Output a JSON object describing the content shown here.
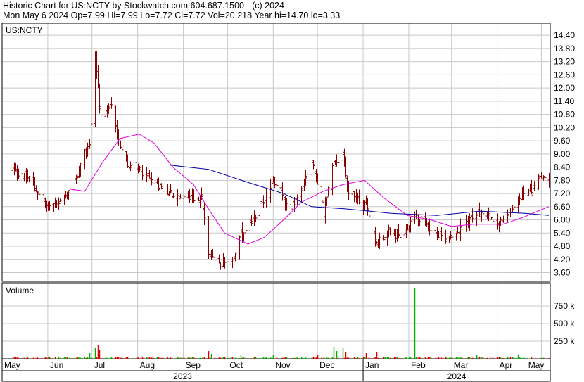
{
  "header": {
    "line1": "Historic Chart for US:NCTY by Stockwatch.com 604.687.1500 - (c) 2024",
    "line2": "Mon May  6 2024  Op=7.99  Hi=7.99  Lo=7.72  Cl=7.72  Vol=20,218  Year hi=14.70  lo=3.33"
  },
  "chart_data": [
    {
      "type": "bar",
      "subtype": "ohlc",
      "symbol_label": "US:NCTY",
      "y_ticks": [
        "3.60",
        "4.20",
        "4.80",
        "5.40",
        "6.00",
        "6.60",
        "7.20",
        "7.80",
        "8.40",
        "9.00",
        "9.60",
        "10.20",
        "10.80",
        "11.40",
        "12.00",
        "12.60",
        "13.20",
        "13.80",
        "14.40"
      ],
      "ylim": [
        3.2,
        14.95
      ],
      "x_month_labels": [
        "May",
        "Jun",
        "Jul",
        "Aug",
        "Sep",
        "Oct",
        "Nov",
        "Dec",
        "Jan",
        "Feb",
        "Mar",
        "Apr",
        "May"
      ],
      "x_year_labels": [
        "2023",
        "2024"
      ],
      "grid": true,
      "colors": {
        "bar": "#8b0000",
        "ma_short": "#e000e0",
        "ma_long": "#0000a0",
        "grid": "#c8c8c8"
      },
      "anchors": [
        [
          "2023-05-08",
          8.3
        ],
        [
          "2023-05-20",
          7.8
        ],
        [
          "2023-05-31",
          6.6
        ],
        [
          "2023-06-12",
          6.9
        ],
        [
          "2023-06-20",
          7.9
        ],
        [
          "2023-06-29",
          9.5
        ],
        [
          "2023-07-03",
          13.5
        ],
        [
          "2023-07-07",
          10.6
        ],
        [
          "2023-07-15",
          11.2
        ],
        [
          "2023-07-19",
          9.6
        ],
        [
          "2023-07-25",
          8.4
        ],
        [
          "2023-08-03",
          8.2
        ],
        [
          "2023-08-15",
          7.6
        ],
        [
          "2023-08-25",
          7.1
        ],
        [
          "2023-09-05",
          7.0
        ],
        [
          "2023-09-13",
          7.0
        ],
        [
          "2023-09-18",
          4.5
        ],
        [
          "2023-09-25",
          4.0
        ],
        [
          "2023-10-05",
          4.2
        ],
        [
          "2023-10-10",
          5.3
        ],
        [
          "2023-10-20",
          6.2
        ],
        [
          "2023-11-01",
          7.8
        ],
        [
          "2023-11-12",
          6.5
        ],
        [
          "2023-11-20",
          7.2
        ],
        [
          "2023-11-27",
          8.8
        ],
        [
          "2023-12-05",
          6.4
        ],
        [
          "2023-12-12",
          8.6
        ],
        [
          "2023-12-18",
          9.0
        ],
        [
          "2023-12-22",
          7.3
        ],
        [
          "2024-01-03",
          6.6
        ],
        [
          "2024-01-10",
          5.0
        ],
        [
          "2024-01-18",
          5.4
        ],
        [
          "2024-01-28",
          5.2
        ],
        [
          "2024-02-05",
          6.3
        ],
        [
          "2024-02-15",
          5.6
        ],
        [
          "2024-02-25",
          5.2
        ],
        [
          "2024-03-08",
          5.6
        ],
        [
          "2024-03-18",
          6.3
        ],
        [
          "2024-03-28",
          6.1
        ],
        [
          "2024-04-05",
          5.9
        ],
        [
          "2024-04-15",
          7.0
        ],
        [
          "2024-04-26",
          7.5
        ],
        [
          "2024-05-02",
          8.0
        ],
        [
          "2024-05-06",
          7.72
        ]
      ],
      "ma_short": [
        [
          "2023-06-16",
          7.4
        ],
        [
          "2023-06-26",
          7.3
        ],
        [
          "2023-07-08",
          8.6
        ],
        [
          "2023-07-20",
          9.7
        ],
        [
          "2023-08-02",
          9.9
        ],
        [
          "2023-08-12",
          9.5
        ],
        [
          "2023-08-25",
          8.4
        ],
        [
          "2023-09-08",
          7.6
        ],
        [
          "2023-09-18",
          6.5
        ],
        [
          "2023-09-29",
          5.4
        ],
        [
          "2023-10-15",
          4.9
        ],
        [
          "2023-10-26",
          5.2
        ],
        [
          "2023-11-08",
          6.0
        ],
        [
          "2023-11-20",
          6.8
        ],
        [
          "2023-12-05",
          7.3
        ],
        [
          "2023-12-18",
          7.6
        ],
        [
          "2024-01-02",
          7.8
        ],
        [
          "2024-01-15",
          7.0
        ],
        [
          "2024-01-31",
          6.2
        ],
        [
          "2024-02-16",
          6.0
        ],
        [
          "2024-03-01",
          5.7
        ],
        [
          "2024-03-16",
          5.8
        ],
        [
          "2024-04-05",
          5.8
        ],
        [
          "2024-04-18",
          6.1
        ],
        [
          "2024-05-06",
          6.6
        ]
      ],
      "ma_long": [
        [
          "2023-08-22",
          8.5
        ],
        [
          "2023-09-18",
          8.3
        ],
        [
          "2023-10-15",
          7.7
        ],
        [
          "2023-11-08",
          7.2
        ],
        [
          "2023-11-27",
          6.6
        ],
        [
          "2023-12-20",
          6.5
        ],
        [
          "2024-01-20",
          6.3
        ],
        [
          "2024-02-20",
          6.2
        ],
        [
          "2024-03-20",
          6.4
        ],
        [
          "2024-04-20",
          6.3
        ],
        [
          "2024-05-06",
          6.2
        ]
      ]
    },
    {
      "type": "bar",
      "title": "Volume",
      "y_ticks": [
        "250 k",
        "500 k",
        "750 k"
      ],
      "ylim": [
        0,
        1000
      ],
      "y_unit": "k shares",
      "colors": {
        "up": "#00b000",
        "down": "#e00000"
      },
      "spikes": [
        [
          "2023-06-29",
          80
        ],
        [
          "2023-07-03",
          150
        ],
        [
          "2023-07-05",
          200
        ],
        [
          "2023-07-06",
          120
        ],
        [
          "2023-09-18",
          110
        ],
        [
          "2023-09-20",
          70
        ],
        [
          "2023-10-10",
          60
        ],
        [
          "2023-11-01",
          60
        ],
        [
          "2023-12-01",
          60
        ],
        [
          "2023-12-12",
          170
        ],
        [
          "2023-12-14",
          110
        ],
        [
          "2023-12-18",
          150
        ],
        [
          "2023-12-20",
          100
        ],
        [
          "2024-01-03",
          80
        ],
        [
          "2024-01-10",
          90
        ],
        [
          "2024-02-05",
          1000
        ],
        [
          "2024-03-18",
          60
        ],
        [
          "2024-04-15",
          55
        ]
      ]
    }
  ]
}
